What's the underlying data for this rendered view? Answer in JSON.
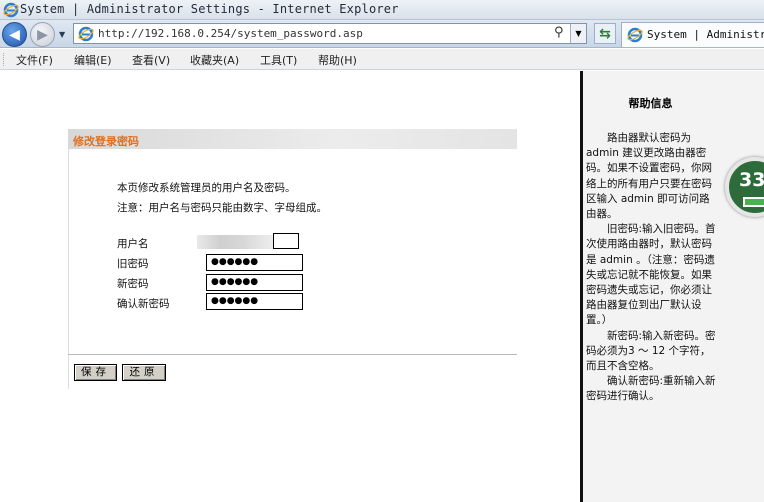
{
  "window": {
    "title": "System | Administrator Settings - Internet Explorer"
  },
  "address_bar": {
    "url": "http://192.168.0.254/system_password.asp"
  },
  "tab": {
    "label": "System | Administrat"
  },
  "menu": [
    "文件(F)",
    "编辑(E)",
    "查看(V)",
    "收藏夹(A)",
    "工具(T)",
    "帮助(H)"
  ],
  "form": {
    "section_title": "修改登录密码",
    "intro_line1": "本页修改系统管理员的用户名及密码。",
    "intro_line2": "注意：用户名与密码只能由数字、字母组成。",
    "username_label": "用户名",
    "old_password_label": "旧密码",
    "new_password_label": "新密码",
    "confirm_password_label": "确认新密码",
    "old_password_value": "●●●●●●",
    "new_password_value": "●●●●●●",
    "confirm_password_value": "●●●●●●",
    "save_label": "保存",
    "restore_label": "还原"
  },
  "help": {
    "title": "帮助信息",
    "p1": "路由器默认密码为admin 建议更改路由器密码。如果不设置密码，你网络上的所有用户只要在密码区输入 admin 即可访问路由器。",
    "p2": "旧密码:输入旧密码。首次使用路由器时，默认密码是 admin 。（注意：密码遗失或忘记就不能恢复。如果密码遗失或忘记，你必须让路由器复位到出厂默认设置。）",
    "p3": "新密码:输入新密码。密码必须为3 ～ 12 个字符，而且不含空格。",
    "p4": "确认新密码:重新输入新密码进行确认。"
  },
  "badge": {
    "value": "33"
  }
}
